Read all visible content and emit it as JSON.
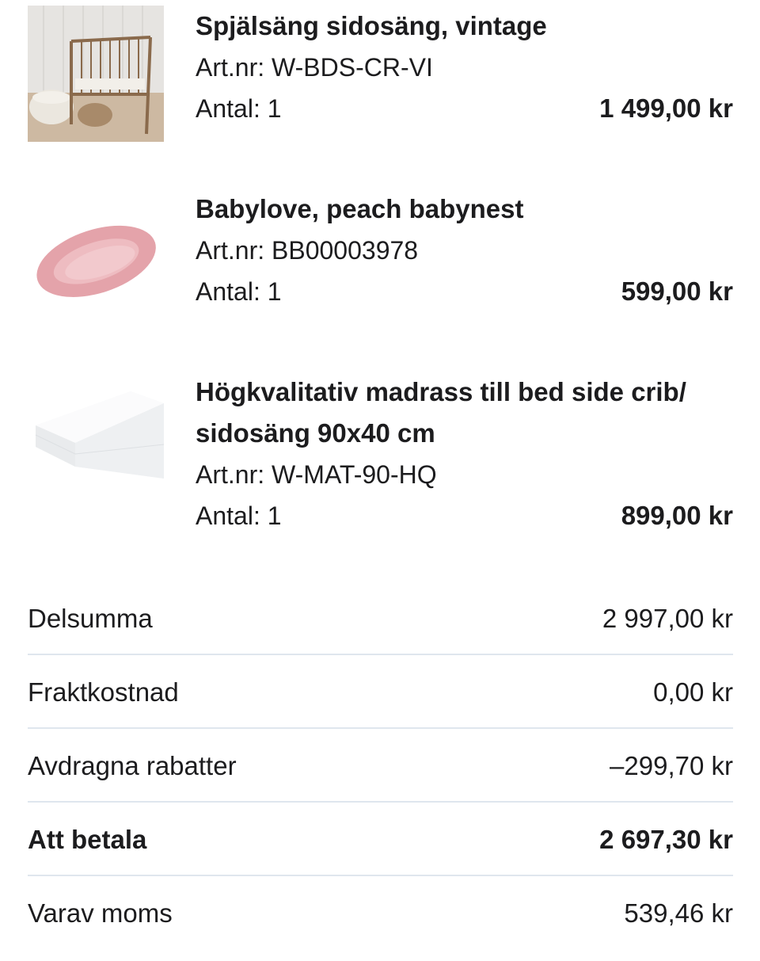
{
  "items": [
    {
      "name": "Spjälsäng sidosäng, vintage",
      "art": "Art.nr: W-BDS-CR-VI",
      "qty": "Antal: 1",
      "price": "1 499,00 kr",
      "image_icon": "crib-image"
    },
    {
      "name": "Babylove, peach babynest",
      "art": "Art.nr: BB00003978",
      "qty": "Antal: 1",
      "price": "599,00 kr",
      "image_icon": "babynest-image"
    },
    {
      "name_line1": "Högkvalitativ madrass till bed side crib/",
      "name_line2": "sidosäng 90x40 cm",
      "art": "Art.nr: W-MAT-90-HQ",
      "qty": "Antal: 1",
      "price": "899,00 kr",
      "image_icon": "mattress-image"
    }
  ],
  "summary": {
    "subtotal_label": "Delsumma",
    "subtotal_value": "2 997,00 kr",
    "shipping_label": "Fraktkostnad",
    "shipping_value": "0,00 kr",
    "discount_label": "Avdragna rabatter",
    "discount_value": "–299,70 kr",
    "total_label": "Att betala",
    "total_value": "2 697,30 kr",
    "vat_label": "Varav moms",
    "vat_value": "539,46 kr"
  },
  "colors": {
    "divider": "#dfe6ee",
    "text": "#1c1c1e",
    "nest_pink": "#e8a8ae",
    "crib_wood": "#8a6a4c"
  }
}
